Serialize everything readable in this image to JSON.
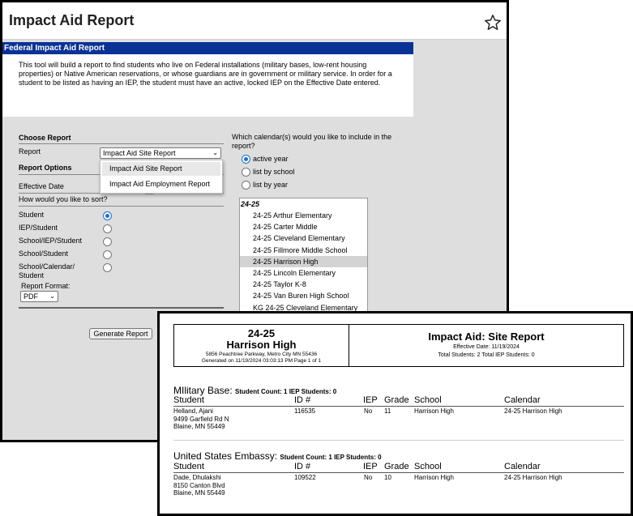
{
  "app": {
    "title": "Impact Aid Report",
    "panel_header": "Federal Impact Aid Report",
    "intro": "This tool will build a report to find students who live on Federal installations (military bases, low-rent housing properties) or Native American reservations, or whose guardians are in government or military service. In order for a student to be listed as having an IEP, the student must have an active, locked IEP on the Effective Date entered."
  },
  "form": {
    "choose_report_heading": "Choose Report",
    "report_label": "Report",
    "report_selected": "Impact Aid Site Report",
    "report_options": [
      "Impact Aid Site Report",
      "Impact Aid Employment Report"
    ],
    "report_options_heading": "Report Options",
    "effective_date_label": "Effective Date",
    "sort_question": "How would you like to sort?",
    "sort_options": [
      "Student",
      "IEP/Student",
      "School/IEP/Student",
      "School/Student",
      "School/Calendar/ Student"
    ],
    "sort_selected_index": 0,
    "format_label": "Report Format:",
    "format_value": "PDF",
    "generate_label": "Generate Report"
  },
  "calendar": {
    "question": "Which calendar(s) would you like to include in the report?",
    "options": [
      "active year",
      "list by school",
      "list by year"
    ],
    "selected_index": 0,
    "group_label": "24-25",
    "items": [
      "24-25 Arthur Elementary",
      "24-25 Carter Middle",
      "24-25 Cleveland Elementary",
      "24-25 Fillmore Middle School",
      "24-25 Harrison High",
      "24-25 Lincoln Elementary",
      "24-25 Taylor K-8",
      "24-25 Van Buren High School",
      "KG 24-25 Cleveland Elementary"
    ],
    "selected_item_index": 4
  },
  "report": {
    "year": "24-25",
    "school": "Harrison High",
    "address": "5856 Peachtree Parkway, Metro City  MN 55436",
    "generated": "Generated on 11/19/2024 03:03:13 PM     Page 1 of  1",
    "title": "Impact Aid: Site Report",
    "effective_date": "Effective Date: 11/19/2024",
    "totals": "Total Students: 2     Total IEP Students: 0",
    "columns": [
      "Student",
      "ID #",
      "IEP",
      "Grade",
      "School",
      "Calendar"
    ],
    "sections": [
      {
        "name": "MIlitary Base:",
        "meta": "Student Count: 1   IEP Students: 0",
        "rows": [
          {
            "student": "Helland, Ajani",
            "addr1": "9499 Garfield Rd N",
            "addr2": "Blaine, MN 55449",
            "id": "116535",
            "iep": "No",
            "grade": "11",
            "school": "Harrison High",
            "calendar": "24-25 Harrison High"
          }
        ]
      },
      {
        "name": "United States Embassy:",
        "meta": "Student Count: 1   IEP Students: 0",
        "rows": [
          {
            "student": "Dade, Dhulakshi",
            "addr1": "8150 Canton Blvd",
            "addr2": "Blaine, MN 55449",
            "id": "109522",
            "iep": "No",
            "grade": "10",
            "school": "Harrison High",
            "calendar": "24-25 Harrison High"
          }
        ]
      }
    ]
  },
  "icons": {
    "favorite": "star-icon",
    "dropdown": "chevron-down-icon"
  }
}
